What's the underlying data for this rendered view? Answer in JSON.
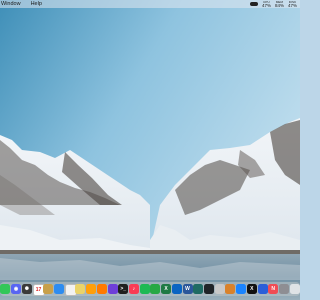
{
  "menubar": {
    "items": [
      "Window",
      "Help"
    ],
    "stats": [
      {
        "label": "CPU",
        "value": "47%"
      },
      {
        "label": "MEM",
        "value": "84%"
      },
      {
        "label": "DISK",
        "value": "47%"
      }
    ]
  },
  "dock": {
    "apps": [
      {
        "name": "messages-icon",
        "color": "#32c759"
      },
      {
        "name": "discord-icon",
        "color": "#5865f2",
        "glyph": "◉"
      },
      {
        "name": "chatgpt-icon",
        "color": "#3a3a3a",
        "glyph": "✺"
      },
      {
        "name": "calendar-icon",
        "color": "#ffffff",
        "glyph": "17",
        "dark": true
      },
      {
        "name": "notes-icon",
        "color": "#c8a04a"
      },
      {
        "name": "finder-icon",
        "color": "#2d8cf0"
      },
      {
        "name": "reminders-icon",
        "color": "#f2f2f2",
        "dark": true
      },
      {
        "name": "sticky-icon",
        "color": "#e9d36a"
      },
      {
        "name": "photos-icon",
        "color": "#ff9f0a"
      },
      {
        "name": "books-icon",
        "color": "#ff7a00"
      },
      {
        "name": "podcasts-icon",
        "color": "#6e3fd9"
      },
      {
        "name": "terminal-icon",
        "color": "#202020",
        "glyph": ">_"
      },
      {
        "name": "music-icon",
        "color": "#fa3c55",
        "glyph": "♪"
      },
      {
        "name": "spotify-icon",
        "color": "#1db954"
      },
      {
        "name": "app-green-icon",
        "color": "#27a844"
      },
      {
        "name": "excel-icon",
        "color": "#1f7a45",
        "glyph": "X"
      },
      {
        "name": "outlook-icon",
        "color": "#0a64c2"
      },
      {
        "name": "word-icon",
        "color": "#2b579a",
        "glyph": "W"
      },
      {
        "name": "app-teal-icon",
        "color": "#1e6b63"
      },
      {
        "name": "app-dark-icon",
        "color": "#202428"
      },
      {
        "name": "app-gray-icon",
        "color": "#c9c9c9"
      },
      {
        "name": "app-orange-icon",
        "color": "#d9822b"
      },
      {
        "name": "safari-icon",
        "color": "#1a84ff"
      },
      {
        "name": "x-icon",
        "color": "#111111",
        "glyph": "X"
      },
      {
        "name": "shield-icon",
        "color": "#2b5fd8"
      },
      {
        "name": "news-icon",
        "color": "#f04d55",
        "glyph": "N"
      },
      {
        "name": "settings-icon",
        "color": "#8e8e93"
      },
      {
        "name": "trash-icon",
        "color": "#dfe3e6"
      }
    ]
  }
}
